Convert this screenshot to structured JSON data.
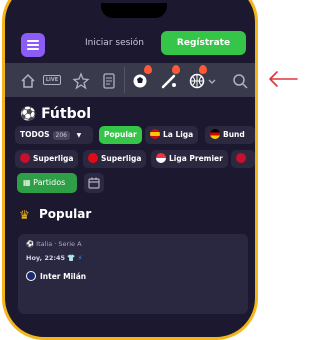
{
  "header": {
    "login_label": "Iniciar sesión",
    "register_label": "Regístrate"
  },
  "sport": {
    "title": "Fútbol",
    "icon": "soccer-ball-icon"
  },
  "icon_bar": {
    "icons": [
      "home-icon",
      "live-icon",
      "star-icon",
      "betslip-icon",
      "soccer-hot-icon",
      "baseball-hot-icon",
      "basketball-hot-icon",
      "chevron-down-icon",
      "search-icon"
    ],
    "live_label": "LIVE"
  },
  "filters": {
    "todos_label": "TODOS",
    "todos_count": "206",
    "chips_row1": [
      {
        "label": "Popular",
        "active": true
      },
      {
        "label": "La Liga",
        "flag": "spain"
      },
      {
        "label": "Bund",
        "flag": "germany"
      }
    ],
    "chips_row2": [
      {
        "label": "Superliga",
        "flag": "denmark"
      },
      {
        "label": "Superliga",
        "flag": "turkey"
      },
      {
        "label": "Liga Premier",
        "flag": "singapore"
      }
    ]
  },
  "view_toggle": {
    "partidos_label": "Partidos"
  },
  "popular": {
    "title": "Popular"
  },
  "match": {
    "league": "Italia · Serie A",
    "time": "Hoy, 22:45",
    "home_team": "Inter Milán"
  },
  "colors": {
    "accent_green": "#35c548",
    "purple": "#8b5cf6",
    "phone_border": "#f2b51a",
    "arrow": "#e0363a"
  }
}
